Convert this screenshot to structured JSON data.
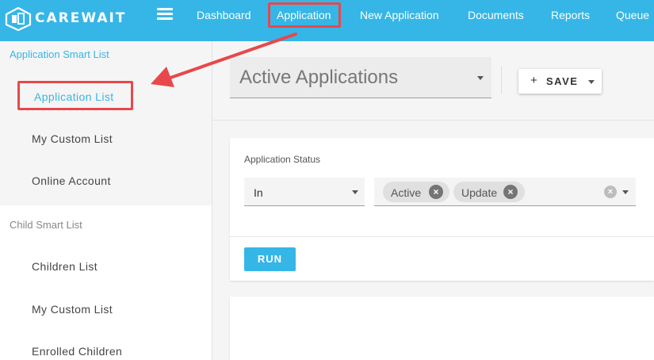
{
  "app": {
    "logo_text": "CAREWAIT"
  },
  "nav": {
    "items": [
      {
        "label": "Dashboard"
      },
      {
        "label": "Application"
      },
      {
        "label": "New Application"
      },
      {
        "label": "Documents"
      },
      {
        "label": "Reports"
      },
      {
        "label": "Queue"
      }
    ]
  },
  "sidebar": {
    "groups": [
      {
        "title": "Application Smart List",
        "items": [
          "Application List",
          "My Custom List",
          "Online Account"
        ]
      },
      {
        "title": "Child Smart List",
        "items": [
          "Children List",
          "My Custom List",
          "Enrolled Children"
        ]
      }
    ]
  },
  "main": {
    "list_select": {
      "value": "Active Applications"
    },
    "save_button": {
      "icon": "+",
      "label": "SAVE"
    },
    "filter": {
      "label": "Application Status",
      "operator": "In",
      "chips": [
        "Active",
        "Update"
      ],
      "run_label": "RUN"
    }
  },
  "colors": {
    "brand": "#35b6e7",
    "annotation": "#e8484b"
  }
}
